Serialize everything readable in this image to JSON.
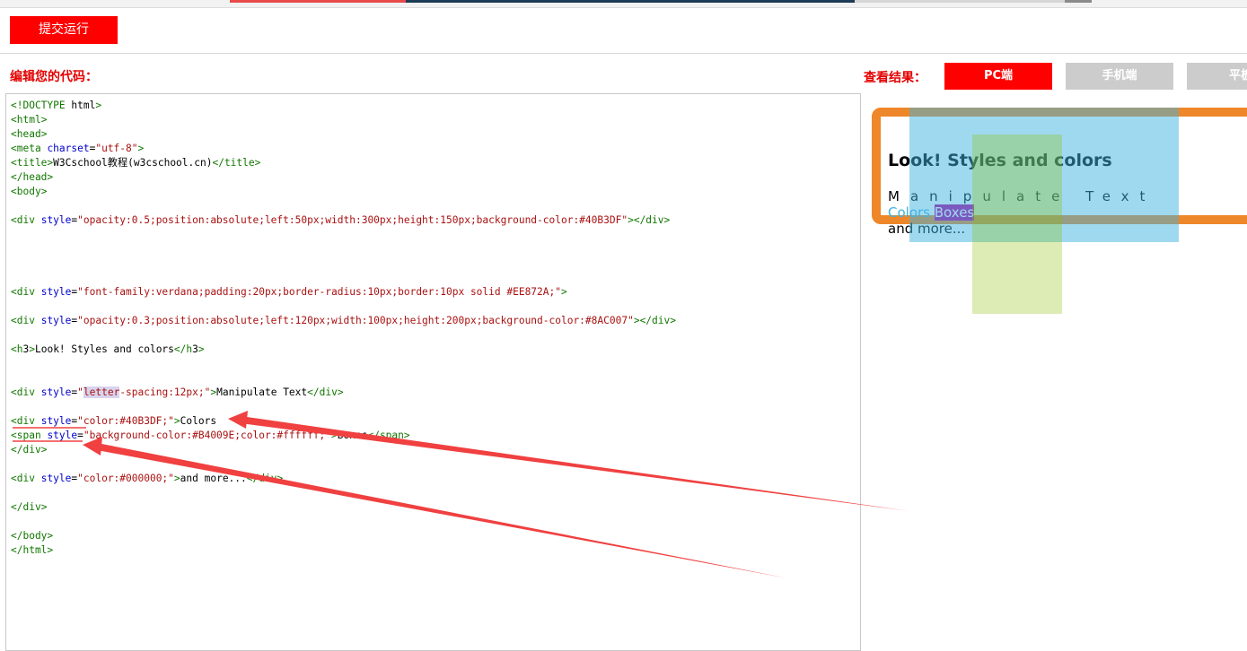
{
  "toolbar": {
    "submit_label": "提交运行"
  },
  "editor": {
    "label": "编辑您的代码：",
    "lines": [
      "<!DOCTYPE html>",
      "<html>",
      "<head>",
      "<meta charset=\"utf-8\">",
      "<title>W3Cschool教程(w3cschool.cn)</title>",
      "</head>",
      "<body>",
      "",
      "<div style=\"opacity:0.5;position:absolute;left:50px;width:300px;height:150px;background-color:#40B3DF\"></div>",
      "",
      "",
      "",
      "",
      "<div style=\"font-family:verdana;padding:20px;border-radius:10px;border:10px solid #EE872A;\">",
      "",
      "<div style=\"opacity:0.3;position:absolute;left:120px;width:100px;height:200px;background-color:#8AC007\"></div>",
      "",
      "<h3>Look! Styles and colors</h3>",
      "",
      "",
      "<div style=\"letter-spacing:12px;\">Manipulate Text</div>",
      "",
      "<div style=\"color:#40B3DF;\">Colors",
      "<span style=\"background-color:#B4009E;color:#ffffff;\">Boxes</span>",
      "</div>",
      "",
      "<div style=\"color:#000000;\">and more...</div>",
      "",
      "</div>",
      "",
      "</body>",
      "</html>"
    ]
  },
  "result": {
    "label": "查看结果：",
    "tabs": [
      {
        "label": "PC端",
        "active": true
      },
      {
        "label": "手机端",
        "active": false
      },
      {
        "label": "平板",
        "active": false
      }
    ],
    "preview": {
      "heading": "Look! Styles and colors",
      "spacing_text": "Manipulate Text",
      "colors_text": "Colors",
      "boxes_text": "Boxes",
      "more_text": "and more..."
    }
  },
  "colors": {
    "accent": "#ff0000",
    "label_red": "#e40000",
    "tab_inactive": "#cccccc",
    "arrow": "#f04040",
    "demo_border": "#EE872A",
    "demo_blue": "#40B3DF",
    "demo_green": "#8AC007",
    "demo_purple": "#B4009E"
  }
}
